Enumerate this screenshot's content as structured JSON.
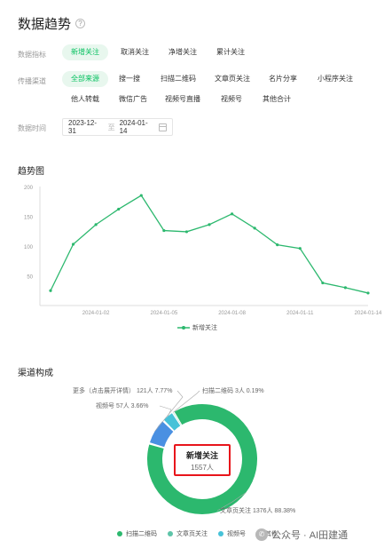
{
  "header": {
    "title": "数据趋势",
    "help_icon": "question-circle-icon"
  },
  "filters": {
    "metric_label": "数据指标",
    "metrics": [
      "新增关注",
      "取消关注",
      "净增关注",
      "累计关注"
    ],
    "active_metric": "新增关注",
    "source_label": "传播渠道",
    "sources": [
      "全部来源",
      "搜一搜",
      "扫描二维码",
      "文章页关注",
      "名片分享",
      "小程序关注",
      "他人转载",
      "微信广告",
      "视频号直播",
      "视频号",
      "其他合计"
    ],
    "active_source": "全部来源",
    "time_label": "数据时间",
    "start_date": "2023-12-31",
    "date_separator": "至",
    "end_date": "2024-01-14",
    "calendar_icon": "calendar-icon"
  },
  "trend": {
    "title": "趋势图",
    "legend_label": "新增关注",
    "color": "#2cb86e"
  },
  "channel": {
    "title": "渠道构成",
    "center_title": "新增关注",
    "center_value": "1557人",
    "legend": [
      "扫描二维码",
      "文章页关注",
      "视频号",
      "其他"
    ],
    "colors": [
      "#2cb86e",
      "#5ec4a8",
      "#47c2d8",
      "#4a90e2"
    ]
  },
  "watermark": {
    "text": "公众号 · AI田建通",
    "icon": "wechat-icon"
  },
  "chart_data": [
    {
      "type": "line",
      "title": "趋势图",
      "x": [
        "2023-12-31",
        "2024-01-01",
        "2024-01-02",
        "2024-01-03",
        "2024-01-04",
        "2024-01-05",
        "2024-01-06",
        "2024-01-07",
        "2024-01-08",
        "2024-01-09",
        "2024-01-10",
        "2024-01-11",
        "2024-01-12",
        "2024-01-13",
        "2024-01-14"
      ],
      "x_tick_labels": [
        "2024-01-02",
        "2024-01-05",
        "2024-01-08",
        "2024-01-11",
        "2024-01-14"
      ],
      "y_ticks": [
        50,
        100,
        150,
        200
      ],
      "ylim": [
        0,
        200
      ],
      "grid": false,
      "legend_position": "bottom",
      "series": [
        {
          "name": "新增关注",
          "values": [
            25,
            103,
            136,
            162,
            185,
            126,
            124,
            136,
            154,
            130,
            102,
            96,
            38,
            30,
            21
          ]
        }
      ]
    },
    {
      "type": "pie",
      "title": "渠道构成",
      "slices": [
        {
          "label": "文章页关注",
          "value": 1376,
          "label_text": "文章页关注 1376人 88.38%"
        },
        {
          "label": "更多（点击展开详情）",
          "value": 121,
          "label_text": "更多（点击展开详情） 121人 7.77%"
        },
        {
          "label": "视频号",
          "value": 57,
          "label_text": "视频号 57人 3.66%"
        },
        {
          "label": "扫描二维码",
          "value": 3,
          "label_text": "扫描二维码 3人 0.19%"
        }
      ],
      "legend_position": "bottom"
    }
  ]
}
